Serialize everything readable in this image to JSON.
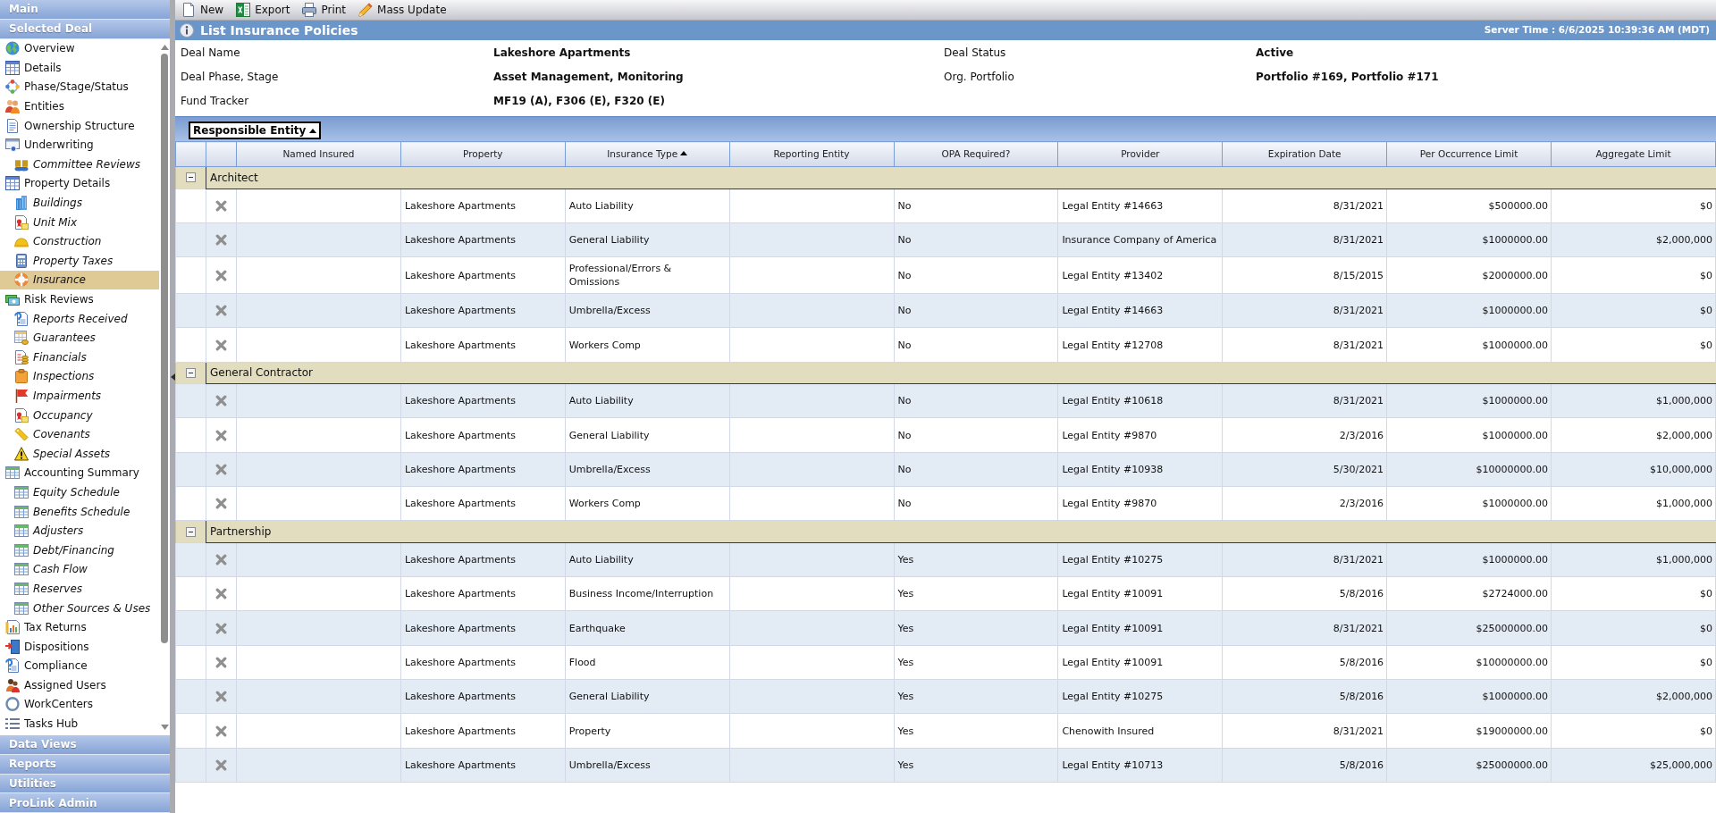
{
  "sidebar": {
    "panels": [
      {
        "label": "Main"
      },
      {
        "label": "Selected Deal",
        "items": [
          {
            "label": "Overview",
            "selected": false
          },
          {
            "label": "Details",
            "selected": false
          },
          {
            "label": "Phase/Stage/Status",
            "selected": false
          },
          {
            "label": "Entities",
            "selected": false
          },
          {
            "label": "Ownership Structure",
            "selected": false
          },
          {
            "label": "Underwriting",
            "selected": false,
            "children": [
              {
                "label": "Committee Reviews",
                "selected": false
              }
            ]
          },
          {
            "label": "Property Details",
            "selected": false,
            "children": [
              {
                "label": "Buildings",
                "selected": false
              },
              {
                "label": "Unit Mix",
                "selected": false
              },
              {
                "label": "Construction",
                "selected": false
              },
              {
                "label": "Property Taxes",
                "selected": false
              },
              {
                "label": "Insurance",
                "selected": true
              }
            ]
          },
          {
            "label": "Risk Reviews",
            "selected": false,
            "children": [
              {
                "label": "Reports Received",
                "selected": false
              },
              {
                "label": "Guarantees",
                "selected": false
              },
              {
                "label": "Financials",
                "selected": false
              },
              {
                "label": "Inspections",
                "selected": false
              },
              {
                "label": "Impairments",
                "selected": false
              },
              {
                "label": "Occupancy",
                "selected": false
              },
              {
                "label": "Covenants",
                "selected": false
              },
              {
                "label": "Special Assets",
                "selected": false
              }
            ]
          },
          {
            "label": "Accounting Summary",
            "selected": false,
            "children": [
              {
                "label": "Equity Schedule",
                "selected": false
              },
              {
                "label": "Benefits Schedule",
                "selected": false
              },
              {
                "label": "Adjusters",
                "selected": false
              },
              {
                "label": "Debt/Financing",
                "selected": false
              },
              {
                "label": "Cash Flow",
                "selected": false
              },
              {
                "label": "Reserves",
                "selected": false
              },
              {
                "label": "Other Sources & Uses",
                "selected": false
              }
            ]
          },
          {
            "label": "Tax Returns",
            "selected": false
          },
          {
            "label": "Dispositions",
            "selected": false
          },
          {
            "label": "Compliance",
            "selected": false
          },
          {
            "label": "Assigned Users",
            "selected": false
          },
          {
            "label": "WorkCenters",
            "selected": false
          },
          {
            "label": "Tasks Hub",
            "selected": false
          }
        ]
      },
      {
        "label": "Data Views"
      },
      {
        "label": "Reports"
      },
      {
        "label": "Utilities"
      },
      {
        "label": "ProLink Admin"
      }
    ]
  },
  "toolbar": {
    "buttons": [
      {
        "label": "New"
      },
      {
        "label": "Export"
      },
      {
        "label": "Print"
      },
      {
        "label": "Mass Update"
      }
    ]
  },
  "title_bar": {
    "title": "List Insurance Policies",
    "server_time": "Server Time : 6/6/2025 10:39:36 AM (MDT)"
  },
  "deal_info": [
    {
      "label": "Deal Name",
      "value": "Lakeshore Apartments"
    },
    {
      "label": "Deal Status",
      "value": "Active"
    },
    {
      "label": "Deal Phase, Stage",
      "value": "Asset Management, Monitoring"
    },
    {
      "label": "Org. Portfolio",
      "value": "Portfolio #169, Portfolio #171"
    },
    {
      "label": "Fund Tracker",
      "value": "MF19 (A), F306 (E), F320 (E)"
    }
  ],
  "grouping": {
    "label": "Responsible Entity",
    "sorted": true
  },
  "table": {
    "columns": [
      {
        "label": "Named Insured",
        "sorted": false
      },
      {
        "label": "Property",
        "sorted": false
      },
      {
        "label": "Insurance Type",
        "sorted": true
      },
      {
        "label": "Reporting Entity",
        "sorted": false
      },
      {
        "label": "OPA Required?",
        "sorted": false
      },
      {
        "label": "Provider",
        "sorted": false
      },
      {
        "label": "Expiration Date",
        "sorted": false
      },
      {
        "label": "Per Occurrence Limit",
        "sorted": false
      },
      {
        "label": "Aggregate Limit",
        "sorted": false
      }
    ],
    "groups": [
      {
        "label": "Architect",
        "expanded": true,
        "rows": [
          {
            "property": "Lakeshore Apartments",
            "insurance_type": "Auto Liability",
            "opa_required": "No",
            "provider": "Legal Entity #14663",
            "expiration_date": "8/31/2021",
            "per_occurrence_limit": "$500000.00",
            "aggregate_limit": "$0"
          },
          {
            "property": "Lakeshore Apartments",
            "insurance_type": "General Liability",
            "opa_required": "No",
            "provider": "Insurance Company of America",
            "expiration_date": "8/31/2021",
            "per_occurrence_limit": "$1000000.00",
            "aggregate_limit": "$2,000,000"
          },
          {
            "property": "Lakeshore Apartments",
            "insurance_type": "Professional/Errors & Omissions",
            "opa_required": "No",
            "provider": "Legal Entity #13402",
            "expiration_date": "8/15/2015",
            "per_occurrence_limit": "$2000000.00",
            "aggregate_limit": "$0"
          },
          {
            "property": "Lakeshore Apartments",
            "insurance_type": "Umbrella/Excess",
            "opa_required": "No",
            "provider": "Legal Entity #14663",
            "expiration_date": "8/31/2021",
            "per_occurrence_limit": "$1000000.00",
            "aggregate_limit": "$0"
          },
          {
            "property": "Lakeshore Apartments",
            "insurance_type": "Workers Comp",
            "opa_required": "No",
            "provider": "Legal Entity #12708",
            "expiration_date": "8/31/2021",
            "per_occurrence_limit": "$1000000.00",
            "aggregate_limit": "$0"
          }
        ]
      },
      {
        "label": "General Contractor",
        "expanded": true,
        "rows": [
          {
            "property": "Lakeshore Apartments",
            "insurance_type": "Auto Liability",
            "opa_required": "No",
            "provider": "Legal Entity #10618",
            "expiration_date": "8/31/2021",
            "per_occurrence_limit": "$1000000.00",
            "aggregate_limit": "$1,000,000"
          },
          {
            "property": "Lakeshore Apartments",
            "insurance_type": "General Liability",
            "opa_required": "No",
            "provider": "Legal Entity #9870",
            "expiration_date": "2/3/2016",
            "per_occurrence_limit": "$1000000.00",
            "aggregate_limit": "$2,000,000"
          },
          {
            "property": "Lakeshore Apartments",
            "insurance_type": "Umbrella/Excess",
            "opa_required": "No",
            "provider": "Legal Entity #10938",
            "expiration_date": "5/30/2021",
            "per_occurrence_limit": "$10000000.00",
            "aggregate_limit": "$10,000,000"
          },
          {
            "property": "Lakeshore Apartments",
            "insurance_type": "Workers Comp",
            "opa_required": "No",
            "provider": "Legal Entity #9870",
            "expiration_date": "2/3/2016",
            "per_occurrence_limit": "$1000000.00",
            "aggregate_limit": "$1,000,000"
          }
        ]
      },
      {
        "label": "Partnership",
        "expanded": true,
        "rows": [
          {
            "property": "Lakeshore Apartments",
            "insurance_type": "Auto Liability",
            "opa_required": "Yes",
            "provider": "Legal Entity #10275",
            "expiration_date": "8/31/2021",
            "per_occurrence_limit": "$1000000.00",
            "aggregate_limit": "$1,000,000"
          },
          {
            "property": "Lakeshore Apartments",
            "insurance_type": "Business Income/Interruption",
            "opa_required": "Yes",
            "provider": "Legal Entity #10091",
            "expiration_date": "5/8/2016",
            "per_occurrence_limit": "$2724000.00",
            "aggregate_limit": "$0"
          },
          {
            "property": "Lakeshore Apartments",
            "insurance_type": "Earthquake",
            "opa_required": "Yes",
            "provider": "Legal Entity #10091",
            "expiration_date": "8/31/2021",
            "per_occurrence_limit": "$25000000.00",
            "aggregate_limit": "$0"
          },
          {
            "property": "Lakeshore Apartments",
            "insurance_type": "Flood",
            "opa_required": "Yes",
            "provider": "Legal Entity #10091",
            "expiration_date": "5/8/2016",
            "per_occurrence_limit": "$10000000.00",
            "aggregate_limit": "$0"
          },
          {
            "property": "Lakeshore Apartments",
            "insurance_type": "General Liability",
            "opa_required": "Yes",
            "provider": "Legal Entity #10275",
            "expiration_date": "5/8/2016",
            "per_occurrence_limit": "$1000000.00",
            "aggregate_limit": "$2,000,000"
          },
          {
            "property": "Lakeshore Apartments",
            "insurance_type": "Property",
            "opa_required": "Yes",
            "provider": "Chenowith Insured",
            "expiration_date": "8/31/2021",
            "per_occurrence_limit": "$19000000.00",
            "aggregate_limit": "$0"
          },
          {
            "property": "Lakeshore Apartments",
            "insurance_type": "Umbrella/Excess",
            "opa_required": "Yes",
            "provider": "Legal Entity #10713",
            "expiration_date": "5/8/2016",
            "per_occurrence_limit": "$25000000.00",
            "aggregate_limit": "$25,000,000"
          }
        ]
      }
    ]
  }
}
